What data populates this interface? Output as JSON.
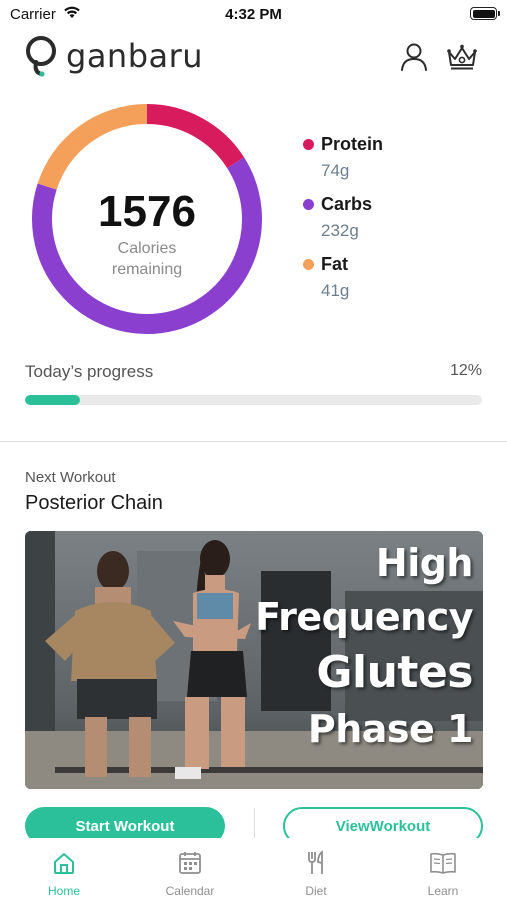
{
  "status_bar": {
    "carrier": "Carrier",
    "time": "4:32 PM"
  },
  "app": {
    "name": "ganbaru"
  },
  "header": {
    "icons": [
      "profile-icon",
      "crown-icon"
    ]
  },
  "calories": {
    "value": "1576",
    "label_line1": "Calories",
    "label_line2": "remaining",
    "ring_fractions": {
      "protein": 0.16,
      "carbs": 0.64,
      "fat": 0.2
    }
  },
  "macros": [
    {
      "name": "Protein",
      "value": "74g",
      "color": "#d81b5d"
    },
    {
      "name": "Carbs",
      "value": "232g",
      "color": "#8a3fcf"
    },
    {
      "name": "Fat",
      "value": "41g",
      "color": "#f5a05a"
    }
  ],
  "progress": {
    "label": "Today’s progress",
    "percent_text": "12%",
    "fraction": 0.12,
    "color": "#2cc09a"
  },
  "workout": {
    "next_label": "Next Workout",
    "title": "Posterior Chain",
    "image_text": [
      "High",
      "Frequency",
      "Glutes",
      "Phase 1"
    ]
  },
  "buttons": {
    "start": "Start Workout",
    "view": "ViewWorkout"
  },
  "tabs": [
    {
      "label": "Home",
      "icon": "home-icon",
      "active": true
    },
    {
      "label": "Calendar",
      "icon": "calendar-icon",
      "active": false
    },
    {
      "label": "Diet",
      "icon": "fork-knife-icon",
      "active": false
    },
    {
      "label": "Learn",
      "icon": "book-icon",
      "active": false
    }
  ],
  "colors": {
    "accent": "#2cc09a"
  }
}
